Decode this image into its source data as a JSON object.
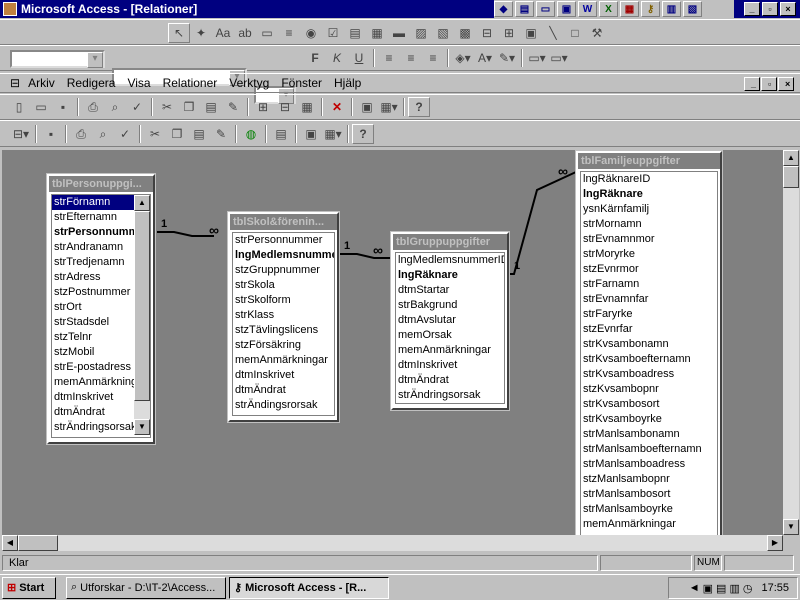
{
  "window": {
    "title": "Microsoft Access - [Relationer]"
  },
  "menu": {
    "items": [
      "Arkiv",
      "Redigera",
      "Visa",
      "Relationer",
      "Verktyg",
      "Fönster",
      "Hjälp"
    ]
  },
  "tables": {
    "personuppgifter": {
      "title": "tblPersonuppgi...",
      "fields": [
        "strFörnamn",
        "strEfternamn",
        "strPersonnumme",
        "strAndranamn",
        "strTredjenamn",
        "strAdress",
        "stzPostnummer",
        "strOrt",
        "strStadsdel",
        "stzTelnr",
        "stzMobil",
        "strE-postadress",
        "memAnmärkningar",
        "dtmInskrivet",
        "dtmÄndrat",
        "strÄndringsorsak"
      ]
    },
    "skolforening": {
      "title": "tblSkol&förenin...",
      "fields": [
        "strPersonnummer",
        "lngMedlemsnummer",
        "stzGruppnummer",
        "strSkola",
        "strSkolform",
        "strKlass",
        "stzTävlingslicens",
        "stzFörsäkring",
        "memAnmärkningar",
        "dtmInskrivet",
        "dtmÄndrat",
        "strÄndingsrorsak"
      ]
    },
    "gruppuppgifter": {
      "title": "tblGruppuppgifter",
      "fields": [
        "lngMedlemsnummerID",
        "lngRäknare",
        "dtmStartar",
        "strBakgrund",
        "dtmAvslutar",
        "memOrsak",
        "memAnmärkningar",
        "dtmInskrivet",
        "dtmÄndrat",
        "strÄndringsorsak"
      ]
    },
    "familjeuppgifter": {
      "title": "tblFamiljeuppgifter",
      "fields": [
        "lngRäknareID",
        "lngRäknare",
        "ysnKärnfamilj",
        "strMornamn",
        "strEvnamnmor",
        "strMoryrke",
        "stzEvnrmor",
        "strFarnamn",
        "strEvnamnfar",
        "strFaryrke",
        "stzEvnrfar",
        "strKvsambonamn",
        "strKvsamboefternamn",
        "strKvsamboadress",
        "stzKvsambopnr",
        "strKvsambosort",
        "strKvsamboyrke",
        "strManlsambonamn",
        "strManlsamboefternamn",
        "strManlsamboadress",
        "stzManlsambopnr",
        "strManlsambosort",
        "strManlsamboyrke",
        "memAnmärkningar"
      ]
    }
  },
  "relations": {
    "one": "1",
    "many": "∞"
  },
  "status": {
    "text": "Klar",
    "num": "NUM"
  },
  "taskbar": {
    "start": "Start",
    "tasks": [
      "Utforskar - D:\\IT-2\\Access...",
      "Microsoft Access - [R..."
    ],
    "clock": "17:55"
  }
}
